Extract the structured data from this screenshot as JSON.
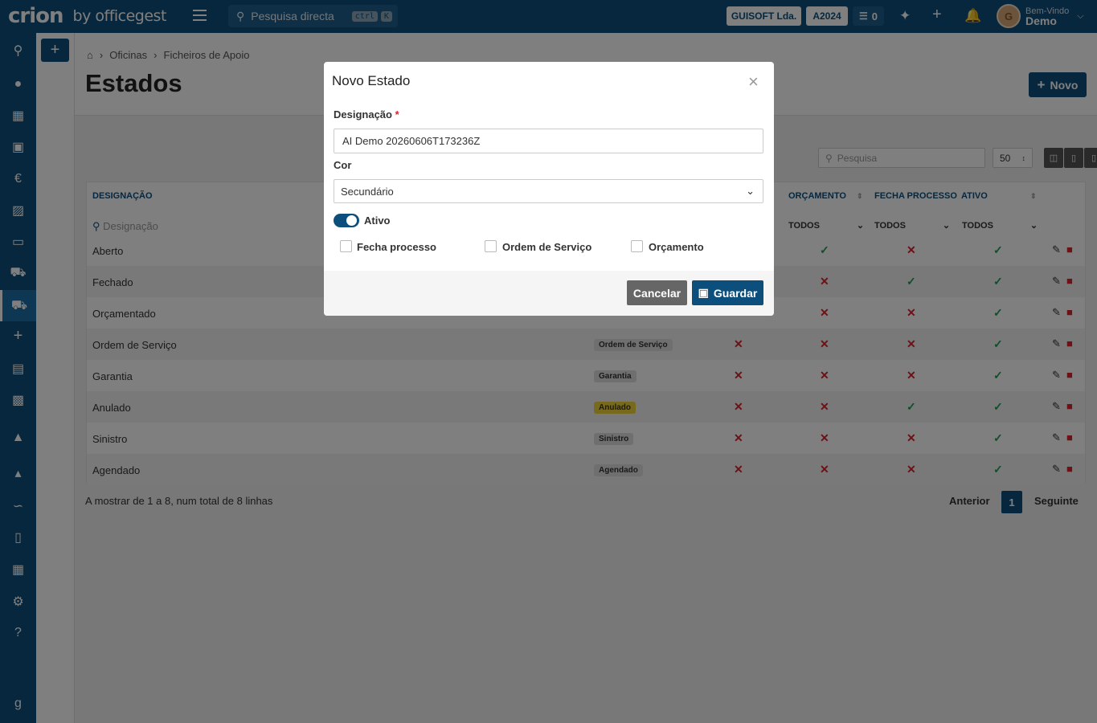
{
  "app": {
    "logo": "crion",
    "logo_sub": "by officegest",
    "search_placeholder": "Pesquisa directa",
    "kbd1": "ctrl",
    "kbd2": "K",
    "company": "GUISOFT Lda.",
    "year": "A2024",
    "tasks_count": "0",
    "greeting": "Bem-Vindo",
    "username": "Demo",
    "avatar_initial": "G"
  },
  "sidebar": {
    "icons": [
      "search-icon",
      "users-icon",
      "book-icon",
      "warehouse-icon",
      "euro-icon",
      "cart-icon",
      "money-icon",
      "truck-icon",
      "car-icon",
      "plus-icon",
      "calculator-icon",
      "box-icon",
      "sitemap-icon",
      "bank-icon",
      "chart-icon",
      "file-icon",
      "table-icon",
      "cogs-icon",
      "help-icon",
      "g-logo-icon"
    ]
  },
  "page": {
    "breadcrumb": [
      "Oficinas",
      "Ficheiros de Apoio"
    ],
    "title": "Estados",
    "new_button": "Novo"
  },
  "table": {
    "search_placeholder": "Pesquisa",
    "page_size": "50",
    "headers": {
      "designacao": "DESIGNAÇÃO",
      "orcamento": "ORÇAMENTO",
      "fecha_processo": "FECHA PROCESSO",
      "ativo": "ATIVO"
    },
    "filter_designacao": "Designação",
    "filter_all": "TODOS",
    "rows": [
      {
        "name": "Aberto",
        "badge": "",
        "os": "",
        "orc": "yes",
        "fecha": "no",
        "ativo": "yes"
      },
      {
        "name": "Fechado",
        "badge": "",
        "os": "",
        "orc": "no",
        "fecha": "yes",
        "ativo": "yes"
      },
      {
        "name": "Orçamentado",
        "badge": "",
        "os": "",
        "orc": "no",
        "fecha": "no",
        "ativo": "yes"
      },
      {
        "name": "Ordem de Serviço",
        "badge": "Ordem de Serviço",
        "os": "no",
        "orc": "no",
        "fecha": "no",
        "ativo": "yes"
      },
      {
        "name": "Garantia",
        "badge": "Garantia",
        "os": "no",
        "orc": "no",
        "fecha": "no",
        "ativo": "yes"
      },
      {
        "name": "Anulado",
        "badge": "Anulado",
        "os": "no",
        "orc": "no",
        "fecha": "yes",
        "ativo": "yes"
      },
      {
        "name": "Sinistro",
        "badge": "Sinistro",
        "os": "no",
        "orc": "no",
        "fecha": "no",
        "ativo": "yes"
      },
      {
        "name": "Agendado",
        "badge": "Agendado",
        "os": "no",
        "orc": "no",
        "fecha": "no",
        "ativo": "yes"
      }
    ],
    "footer_text": "A mostrar de 1 a 8, num total de 8 linhas",
    "prev": "Anterior",
    "page": "1",
    "next": "Seguinte"
  },
  "modal": {
    "title": "Novo Estado",
    "close": "×",
    "designacao_label": "Designação",
    "required_mark": "*",
    "designacao_value": "AI Demo 20260606T173236Z",
    "cor_label": "Cor",
    "cor_value": "Secundário",
    "ativo_label": "Ativo",
    "cb_fecha": "Fecha processo",
    "cb_os": "Ordem de Serviço",
    "cb_orc": "Orçamento",
    "cancel": "Cancelar",
    "save": "Guardar"
  },
  "colors": {
    "primary": "#0d4f7c",
    "yes": "#1f9d55",
    "no": "#d9232d",
    "anulado_badge": "#f0d43a"
  }
}
